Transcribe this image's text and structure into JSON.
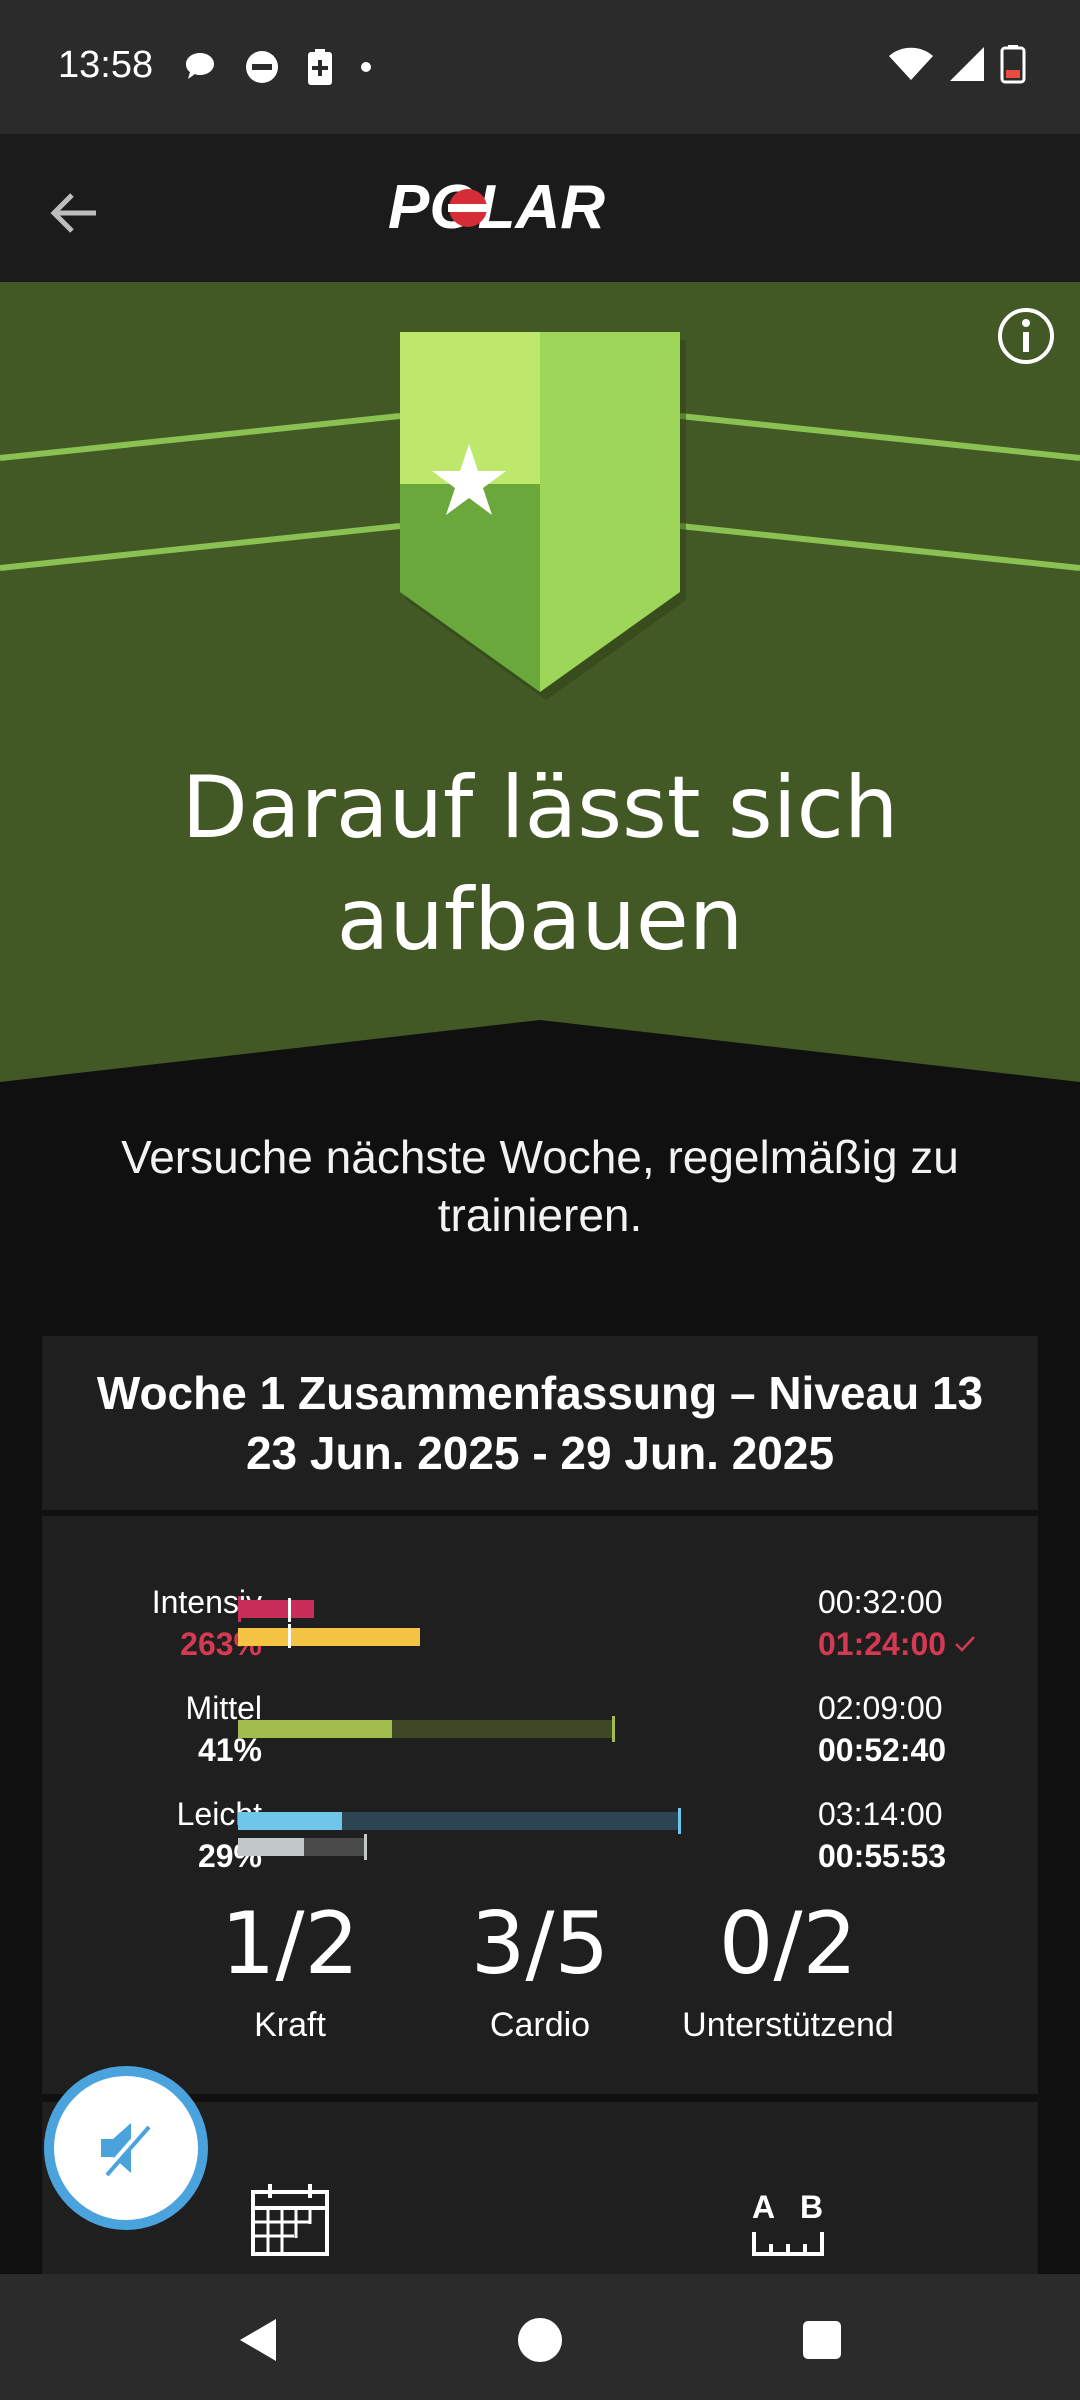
{
  "status_bar": {
    "time": "13:58",
    "left_icons": [
      "chat-bubble-icon",
      "do-not-disturb-icon",
      "battery-saver-icon",
      "dot-icon"
    ],
    "right_icons": [
      "wifi-icon",
      "cell-signal-icon",
      "battery-icon"
    ]
  },
  "app_bar": {
    "back_icon": "arrow-left-icon",
    "logo_text": "POLAR"
  },
  "hero": {
    "badge_icon": "star-badge-icon",
    "info_icon": "info-icon",
    "title": "Darauf lässt sich aufbauen",
    "colors": {
      "background": "#425925",
      "accent": "#a2d95e"
    }
  },
  "subtitle": "Versuche nächste Woche, regelmäßig zu trainieren.",
  "summary": {
    "title": "Woche 1 Zusammenfassung – Niveau 13",
    "date_range": "23 Jun. 2025 - 29 Jun. 2025",
    "zones": [
      {
        "label": "Intensiv",
        "percent": "263%",
        "target": "00:32:00",
        "actual": "01:24:00",
        "percent_color": "#d43a52",
        "goal_reached": true
      },
      {
        "label": "Mittel",
        "percent": "41%",
        "target": "02:09:00",
        "actual": "00:52:40",
        "percent_color": "#ffffff",
        "goal_reached": false
      },
      {
        "label": "Leicht",
        "percent": "29%",
        "target": "03:14:00",
        "actual": "00:55:53",
        "percent_color": "#ffffff",
        "goal_reached": false
      }
    ],
    "counts": [
      {
        "value": "1/2",
        "label": "Kraft"
      },
      {
        "value": "3/5",
        "label": "Cardio"
      },
      {
        "value": "0/2",
        "label": "Unterstützend"
      }
    ]
  },
  "bottom_icons": [
    "calendar-icon",
    "ab-ruler-icon"
  ],
  "fab_icon": "speaker-muted-icon",
  "nav_bar": [
    "back-triangle-icon",
    "home-circle-icon",
    "recents-square-icon"
  ]
}
